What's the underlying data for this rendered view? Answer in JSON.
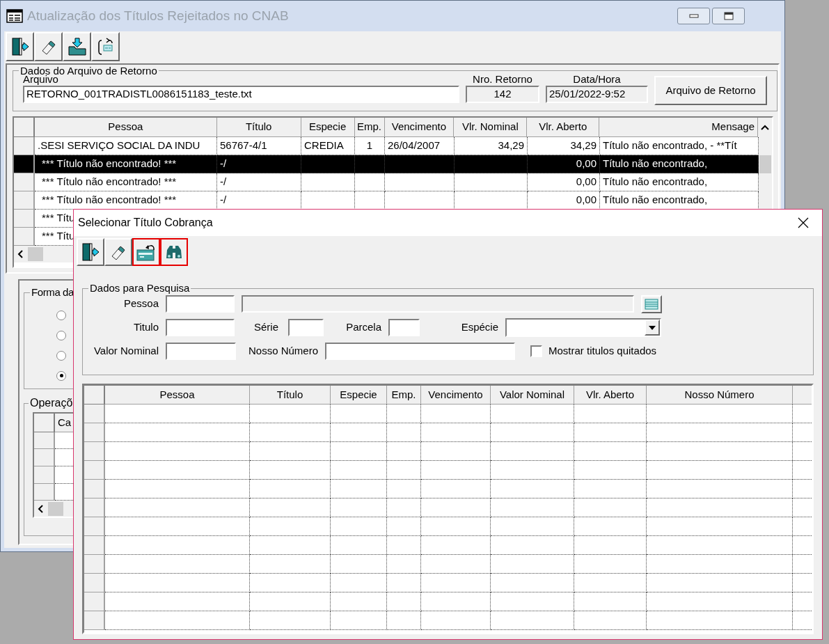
{
  "main_window": {
    "title": "Atualização dos Títulos Rejeitados no CNAB",
    "toolbar": [
      {
        "kind": "exit"
      },
      {
        "kind": "eraser"
      },
      {
        "kind": "import"
      },
      {
        "kind": "refresh"
      }
    ],
    "retorno": {
      "legend": "Dados do Arquivo de Retorno",
      "arquivo_label": "Arquivo",
      "arquivo_value": "RETORNO_001TRADISTL0086151183_teste.txt",
      "nro_label": "Nro. Retorno",
      "nro_value": "142",
      "data_label": "Data/Hora",
      "data_value": "25/01/2022-9:52",
      "button": "Arquivo de Retorno"
    },
    "grid": {
      "columns": [
        "Pessoa",
        "Título",
        "Especie",
        "Emp.",
        "Vencimento",
        "Vlr. Nominal",
        "Vlr. Aberto",
        "Mensage"
      ],
      "rows": [
        {
          "selected": false,
          "cells": [
            ".SESI SERVIÇO SOCIAL DA INDU",
            "56767-4/1",
            "CREDIA",
            "1",
            "26/04/2007",
            "34,29",
            "34,29",
            "Título não encontrado,  - **Tít"
          ]
        },
        {
          "selected": true,
          "cells": [
            "*** Título não encontrado! ***",
            "-/",
            null,
            null,
            null,
            null,
            "0,00",
            "Título não encontrado,"
          ]
        },
        {
          "selected": false,
          "cells": [
            "*** Título não encontrado! ***",
            "-/",
            null,
            null,
            null,
            null,
            "0,00",
            "Título não encontrado,"
          ]
        },
        {
          "selected": false,
          "cells": [
            "*** Título não encontrado! ***",
            "-/",
            null,
            null,
            null,
            null,
            "0,00",
            "Título não encontrado,"
          ]
        },
        {
          "selected": false,
          "cells": [
            "*** Títu",
            null,
            null,
            null,
            null,
            null,
            null,
            null
          ]
        },
        {
          "selected": false,
          "cells": [
            "*** Títu",
            null,
            null,
            null,
            null,
            null,
            null,
            null
          ]
        }
      ]
    },
    "forma": {
      "legend": "Forma da",
      "radios": [
        {
          "selected": false
        },
        {
          "selected": false
        },
        {
          "selected": false
        },
        {
          "selected": true
        }
      ]
    },
    "operacoes": {
      "legend": "Operaçõ",
      "columns": [
        "Ca"
      ]
    }
  },
  "dialog": {
    "title": "Selecionar Título Cobrança",
    "toolbar": [
      {
        "kind": "exit",
        "highlighted": false
      },
      {
        "kind": "eraser",
        "highlighted": false
      },
      {
        "kind": "card",
        "highlighted": true
      },
      {
        "kind": "search",
        "highlighted": true
      }
    ],
    "search": {
      "legend": "Dados para Pesquisa",
      "pessoa_label": "Pessoa",
      "titulo_label": "Titulo",
      "serie_label": "Série",
      "parcela_label": "Parcela",
      "especie_label": "Espécie",
      "valor_label": "Valor Nominal",
      "nosso_label": "Nosso Número",
      "checkbox": {
        "label": "Mostrar titulos quitados",
        "checked": false
      }
    },
    "grid": {
      "columns": [
        "Pessoa",
        "Título",
        "Especie",
        "Emp.",
        "Vencimento",
        "Valor Nominal",
        "Vlr. Aberto",
        "Nosso Número"
      ]
    }
  }
}
